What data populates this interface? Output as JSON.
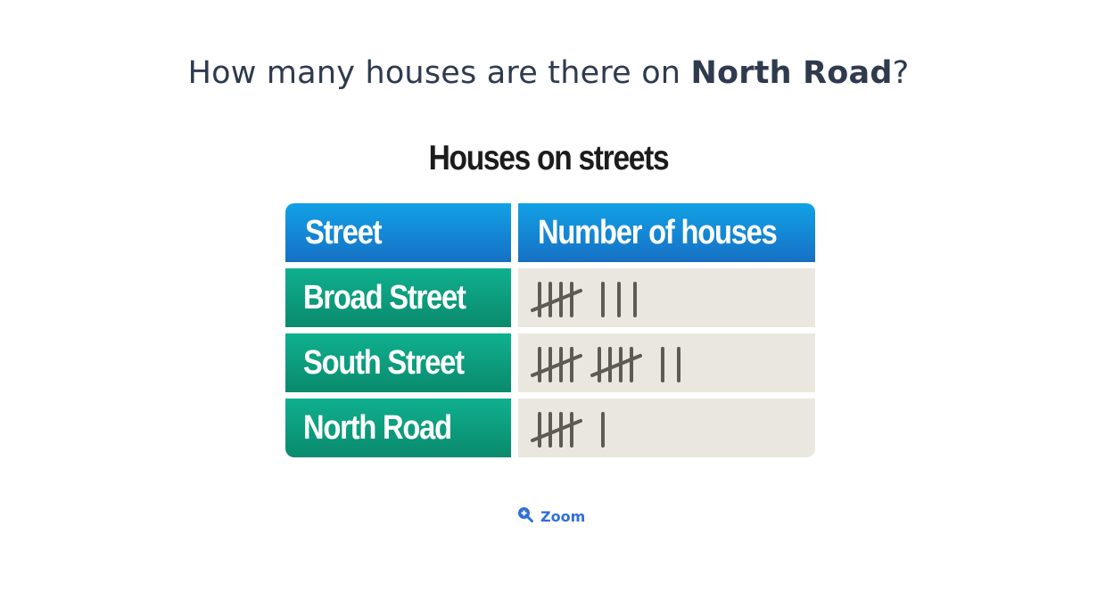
{
  "question": {
    "prefix": "How many houses are there on ",
    "highlight": "North Road",
    "suffix": "?"
  },
  "chart_data": {
    "type": "table",
    "title": "Houses on streets",
    "columns": [
      "Street",
      "Number of houses"
    ],
    "rows": [
      {
        "street": "Broad Street",
        "tally": 8
      },
      {
        "street": "South Street",
        "tally": 12
      },
      {
        "street": "North Road",
        "tally": 6
      }
    ]
  },
  "colors": {
    "header_blue": "#1589d8",
    "row_green": "#0b9e7e",
    "tally_bg": "#eae7df",
    "tally_ink": "#5c5c55",
    "zoom_blue": "#2f6fd6"
  },
  "zoom": {
    "icon": "zoom-in-icon",
    "label": "Zoom"
  }
}
